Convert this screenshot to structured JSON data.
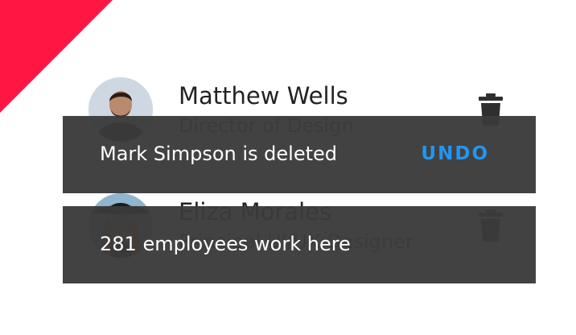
{
  "list": {
    "items": [
      {
        "name": "Matthew Wells",
        "role": "Director of Design",
        "avatar_icon": "person-avatar",
        "delete_icon": "trash-icon"
      },
      {
        "name": "Eliza Morales",
        "role": "Principal UI/UX Designer",
        "avatar_icon": "person-avatar",
        "delete_icon": "trash-icon"
      }
    ]
  },
  "snackbars": [
    {
      "message": "Mark Simpson is deleted",
      "action_label": "UNDO"
    },
    {
      "message": "281 employees work here"
    }
  ],
  "colors": {
    "accent_corner": "#ff1744",
    "snackbar_bg": "#3a3a3a",
    "action_text": "#2196f3",
    "name_text": "#222222",
    "role_text": "#555555"
  }
}
